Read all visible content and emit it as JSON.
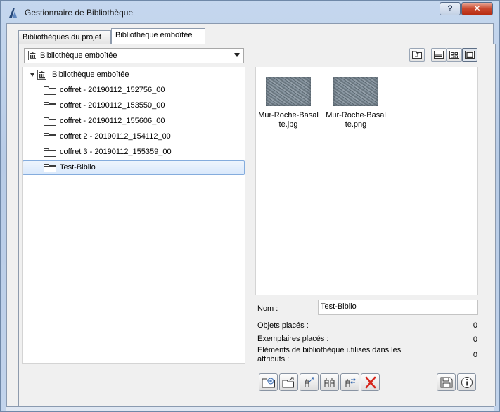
{
  "window": {
    "title": "Gestionnaire de Bibliothèque",
    "help_label": "?",
    "close_label": "✕"
  },
  "tabs": [
    {
      "label": "Bibliothèques du projet",
      "active": false
    },
    {
      "label": "Bibliothèque emboîtée",
      "active": true
    }
  ],
  "library_select": {
    "value": "Bibliothèque emboîtée"
  },
  "tree": {
    "root": "Bibliothèque emboîtée",
    "items": [
      {
        "label": "coffret - 20190112_152756_00",
        "selected": false
      },
      {
        "label": "coffret - 20190112_153550_00",
        "selected": false
      },
      {
        "label": "coffret - 20190112_155606_00",
        "selected": false
      },
      {
        "label": "coffret 2 - 20190112_154112_00",
        "selected": false
      },
      {
        "label": "coffret 3 - 20190112_155359_00",
        "selected": false
      },
      {
        "label": "Test-Biblio",
        "selected": true
      }
    ]
  },
  "view_buttons": [
    "up-folder-icon",
    "list-view-icon",
    "small-icons-view-icon",
    "large-icons-view-icon"
  ],
  "preview": {
    "files": [
      {
        "name": "Mur-Roche-Basalte.jpg",
        "caption_line1": "Mur-Roche-Basal",
        "caption_line2": "te.jpg"
      },
      {
        "name": "Mur-Roche-Basalte.png",
        "caption_line1": "Mur-Roche-Basal",
        "caption_line2": "te.png"
      }
    ]
  },
  "details": {
    "name_label": "Nom :",
    "name_value": "Test-Biblio",
    "placed_objects_label": "Objets placés :",
    "placed_objects_value": "0",
    "placed_instances_label": "Exemplaires placés :",
    "placed_instances_value": "0",
    "used_in_attributes_label_1": "Eléments de bibliothèque utilisés dans les",
    "used_in_attributes_label_2": "attributs :",
    "used_in_attributes_value": "0"
  },
  "actions": [
    "new-folder-icon",
    "add-folder-icon",
    "export-icon",
    "duplicate-icon",
    "move-icon",
    "delete-icon",
    "save-icon",
    "info-icon"
  ],
  "colors": {
    "delete": "#d7261c",
    "selection_border": "#84acdd",
    "folder_stroke": "#3c3c3c"
  }
}
